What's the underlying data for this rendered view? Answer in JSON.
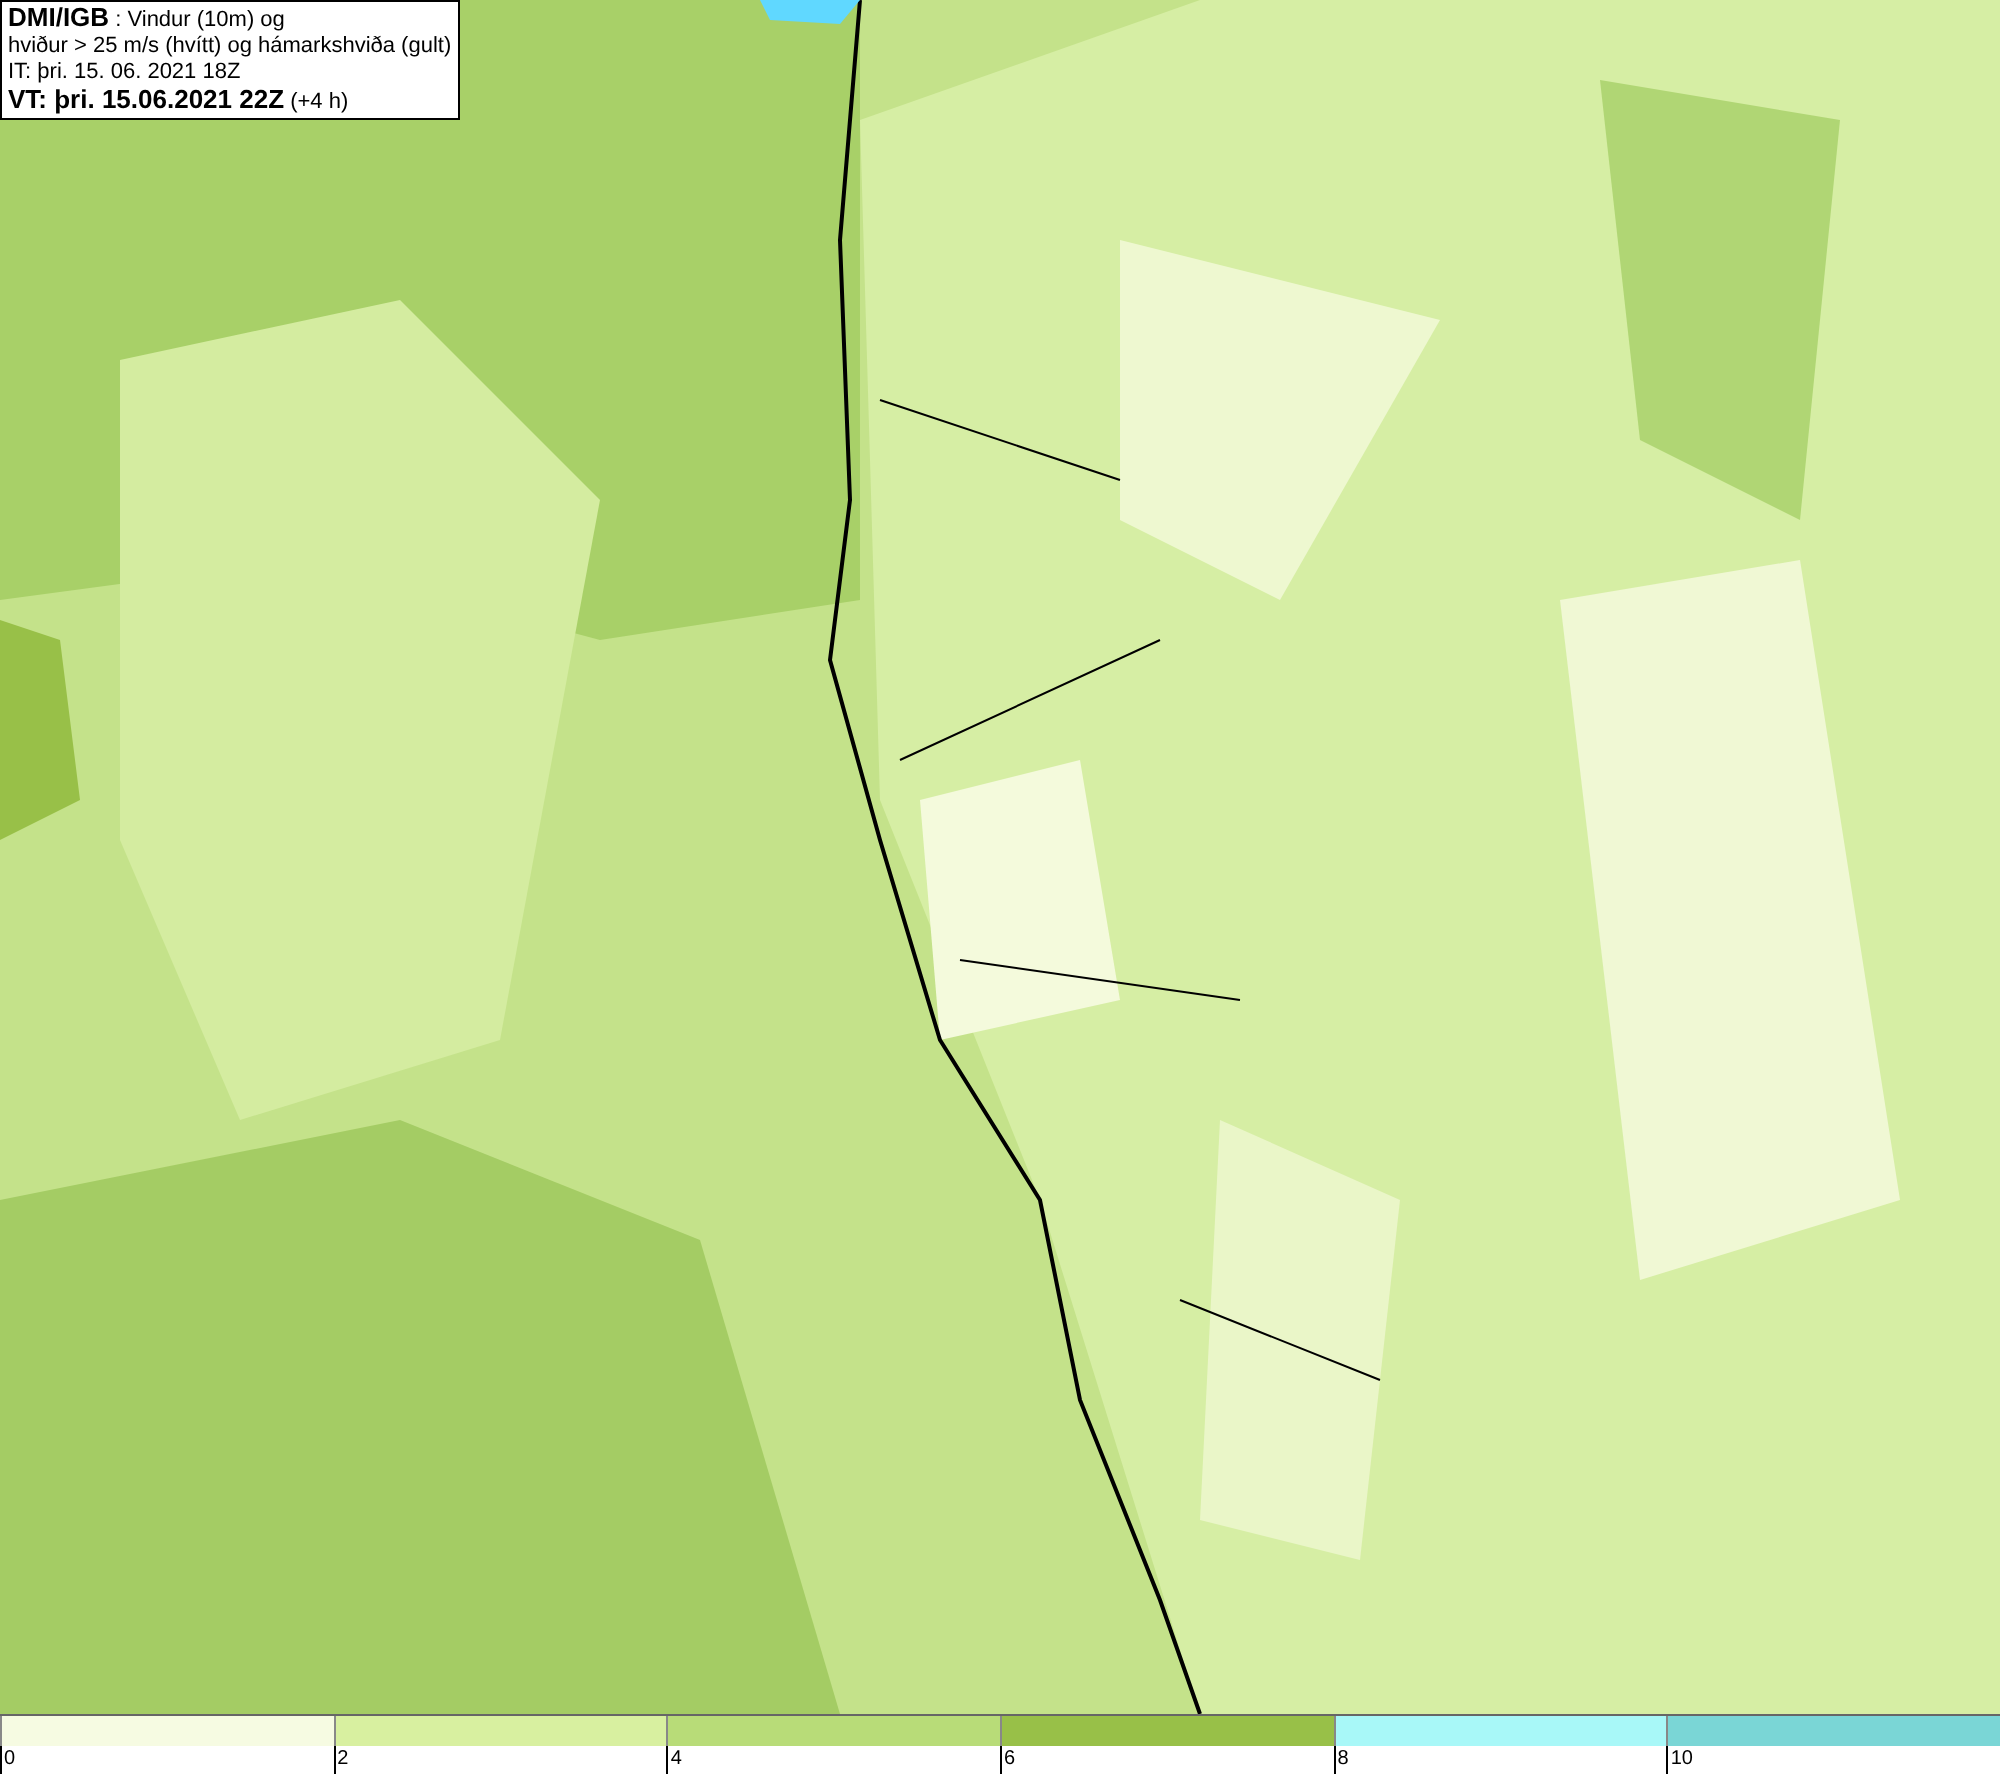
{
  "title_box": {
    "lines": [
      "**DMI/IGB** : Vindur (10m) og",
      "hviður > 25 m/s (hvítt) og hámarkshviða (gult)",
      "IT: þri. 15. 06. 2021 18Z",
      "**VT: þri. 15.06.2021 22Z** (+4 h)"
    ]
  },
  "legend": {
    "segments": [
      {
        "color": "#f6fbe2"
      },
      {
        "color": "#d8f0a0"
      },
      {
        "color": "#b8dc78"
      },
      {
        "color": "#98c048"
      },
      {
        "color": "#a8f8f8"
      },
      {
        "color": "#7ad6d6"
      }
    ],
    "ticks": [
      "0",
      "2",
      "4",
      "6",
      "8",
      "10"
    ]
  }
}
